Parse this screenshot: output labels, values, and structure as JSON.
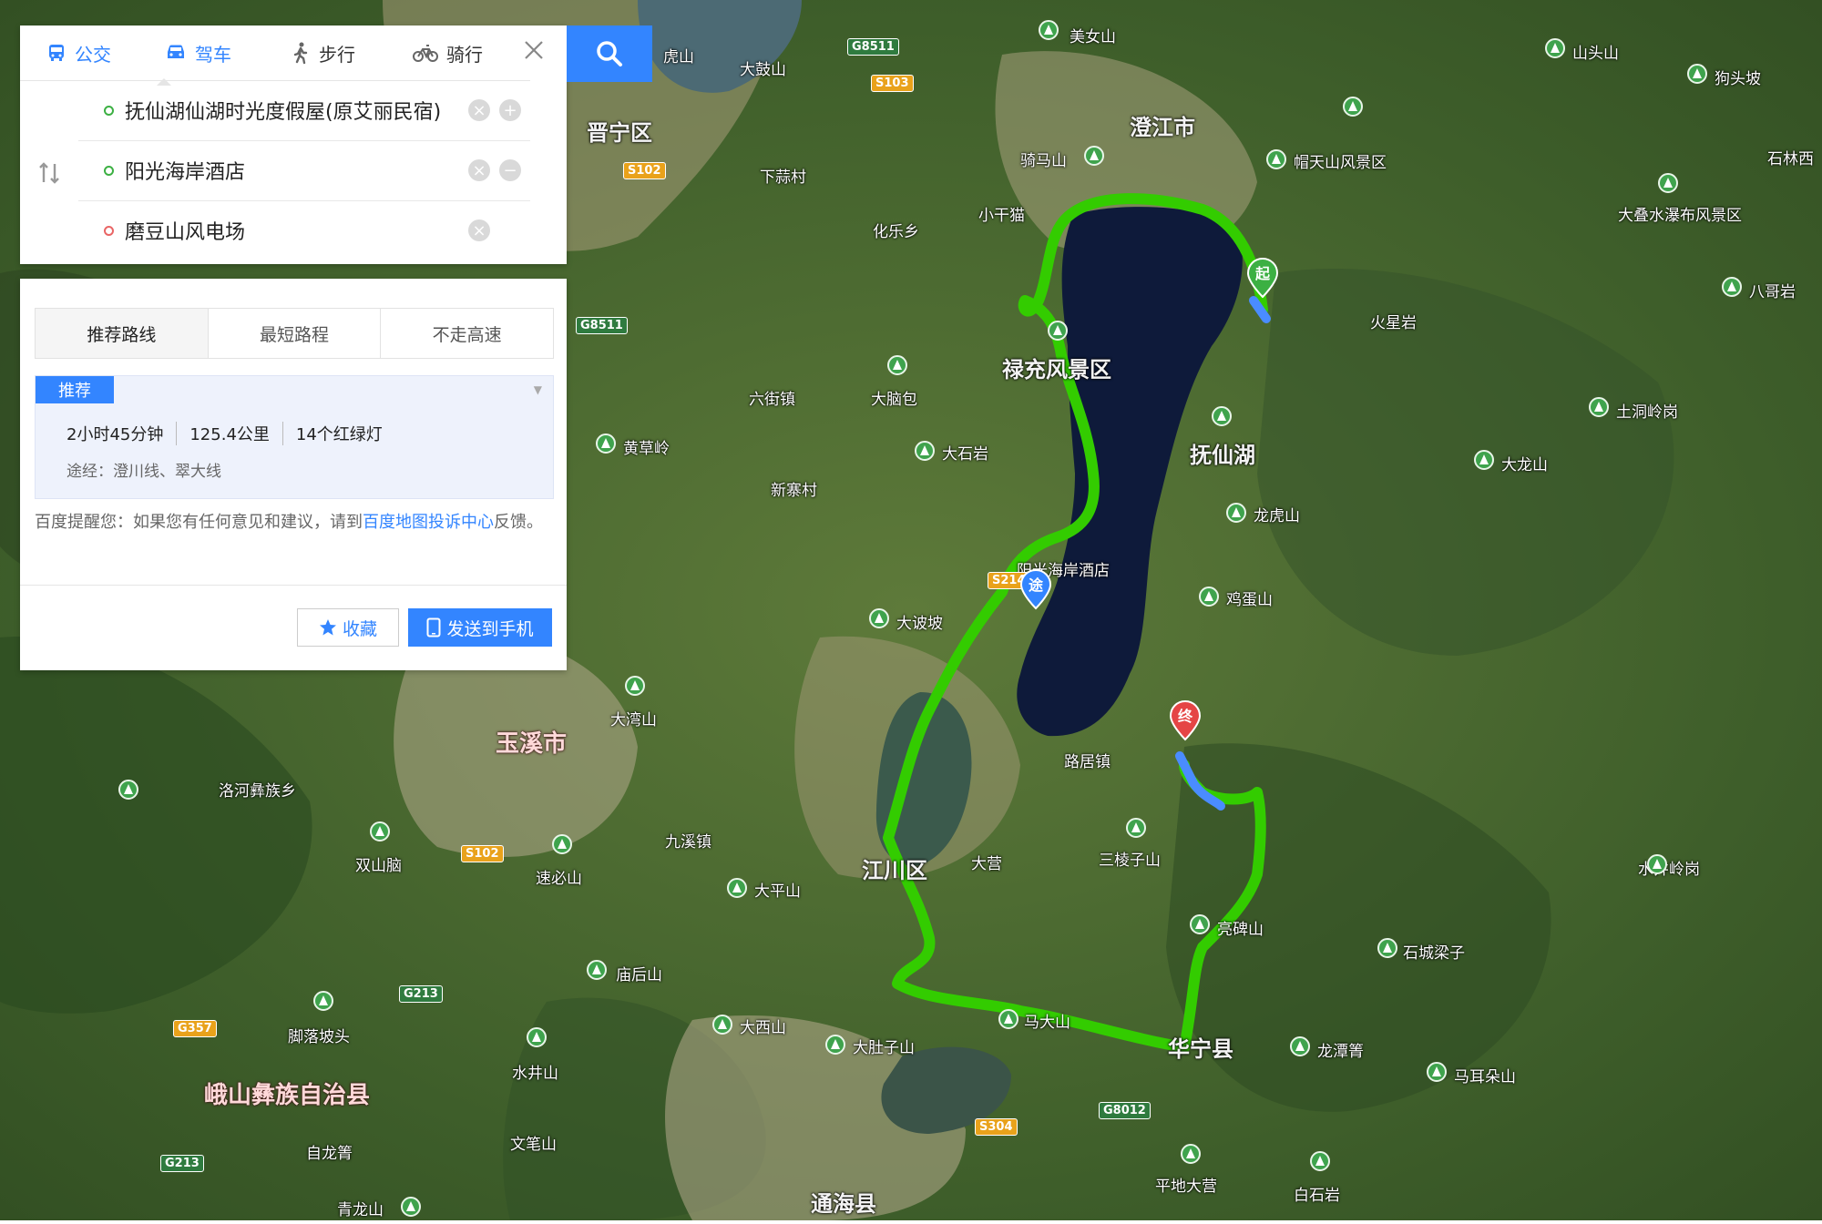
{
  "modes": [
    {
      "label": "公交",
      "icon": "bus-icon"
    },
    {
      "label": "驾车",
      "icon": "car-icon"
    },
    {
      "label": "步行",
      "icon": "walk-icon"
    },
    {
      "label": "骑行",
      "icon": "bike-icon"
    }
  ],
  "route": {
    "start": "抚仙湖仙湖时光度假屋(原艾丽民宿)",
    "via": "阳光海岸酒店",
    "end": "磨豆山风电场",
    "add_symbol": "+",
    "remove_symbol": "−",
    "clear_symbol": "×"
  },
  "tabs": [
    "推荐路线",
    "最短路程",
    "不走高速"
  ],
  "recommend": {
    "badge": "推荐",
    "duration": "2小时45分钟",
    "distance": "125.4公里",
    "lights": "14个红绿灯",
    "via": "途经：澄川线、翠大线"
  },
  "notice": {
    "prefix": "百度提醒您：如果您有任何意见和建议，请到",
    "link": "百度地图投诉中心",
    "suffix": "反馈。"
  },
  "buttons": {
    "favorite": "收藏",
    "send": "发送到手机"
  },
  "markers": {
    "start": "起",
    "via": "途",
    "end": "终"
  },
  "map_labels": [
    {
      "text": "澄江市",
      "cls": "big"
    },
    {
      "text": "晋宁区",
      "cls": "big"
    },
    {
      "text": "玉溪市",
      "cls": "city"
    },
    {
      "text": "江川区",
      "cls": "big"
    },
    {
      "text": "华宁县",
      "cls": "big"
    },
    {
      "text": "通海县",
      "cls": "big"
    },
    {
      "text": "峨山彝族自治县",
      "cls": "city"
    },
    {
      "text": "禄充风景区",
      "cls": "big"
    },
    {
      "text": "抚仙湖",
      "cls": "big"
    },
    {
      "text": "帽天山风景区",
      "cls": ""
    },
    {
      "text": "大叠水瀑布风景区",
      "cls": ""
    },
    {
      "text": "美女山",
      "cls": ""
    },
    {
      "text": "骑马山",
      "cls": ""
    },
    {
      "text": "火星岩",
      "cls": ""
    },
    {
      "text": "大脑包",
      "cls": ""
    },
    {
      "text": "大石岩",
      "cls": ""
    },
    {
      "text": "黄草岭",
      "cls": ""
    },
    {
      "text": "龙虎山",
      "cls": ""
    },
    {
      "text": "鸡蛋山",
      "cls": ""
    },
    {
      "text": "大诐坡",
      "cls": ""
    },
    {
      "text": "大湾山",
      "cls": ""
    },
    {
      "text": "路居镇",
      "cls": ""
    },
    {
      "text": "三棱子山",
      "cls": ""
    },
    {
      "text": "亮碑山",
      "cls": ""
    },
    {
      "text": "马大山",
      "cls": ""
    },
    {
      "text": "大肚子山",
      "cls": ""
    },
    {
      "text": "大平山",
      "cls": ""
    },
    {
      "text": "庙后山",
      "cls": ""
    },
    {
      "text": "大西山",
      "cls": ""
    },
    {
      "text": "速必山",
      "cls": ""
    },
    {
      "text": "双山脑",
      "cls": ""
    },
    {
      "text": "洛河彝族乡",
      "cls": ""
    },
    {
      "text": "脚落坡头",
      "cls": ""
    },
    {
      "text": "水井山",
      "cls": ""
    },
    {
      "text": "文笔山",
      "cls": ""
    },
    {
      "text": "石城梁子",
      "cls": ""
    },
    {
      "text": "龙潭箐",
      "cls": ""
    },
    {
      "text": "马耳朵山",
      "cls": ""
    },
    {
      "text": "土洞岭岗",
      "cls": ""
    },
    {
      "text": "大龙山",
      "cls": ""
    },
    {
      "text": "水井岭岗",
      "cls": ""
    },
    {
      "text": "山头山",
      "cls": ""
    },
    {
      "text": "狗头坡",
      "cls": ""
    },
    {
      "text": "八哥岩",
      "cls": ""
    },
    {
      "text": "石林西",
      "cls": ""
    },
    {
      "text": "平地大营",
      "cls": ""
    },
    {
      "text": "白石岩",
      "cls": ""
    },
    {
      "text": "九溪镇",
      "cls": ""
    },
    {
      "text": "六街镇",
      "cls": ""
    },
    {
      "text": "青龙山",
      "cls": ""
    },
    {
      "text": "自龙箐",
      "cls": ""
    },
    {
      "text": "小干猫",
      "cls": ""
    },
    {
      "text": "化乐乡",
      "cls": ""
    },
    {
      "text": "下蒜村",
      "cls": ""
    },
    {
      "text": "大鼓山",
      "cls": ""
    },
    {
      "text": "虎山",
      "cls": ""
    },
    {
      "text": "新寨村",
      "cls": ""
    },
    {
      "text": "大营",
      "cls": ""
    },
    {
      "text": "阳光海岸酒店",
      "cls": ""
    }
  ],
  "roads": [
    "G8511",
    "S103",
    "S102",
    "G8511",
    "S214",
    "S102",
    "G213",
    "G357",
    "G213",
    "S304",
    "G8012"
  ]
}
